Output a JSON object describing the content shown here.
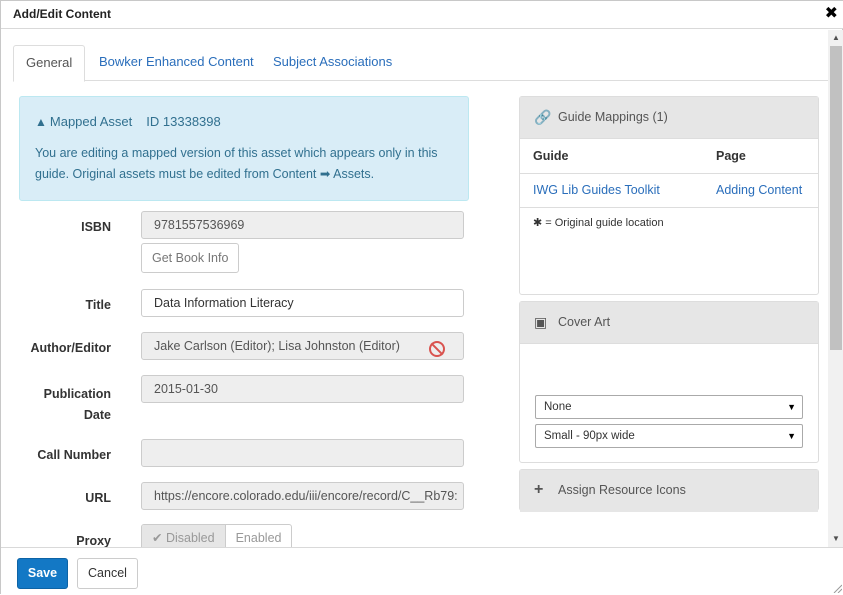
{
  "dialog": {
    "title": "Add/Edit Content",
    "close_glyph": "✖"
  },
  "tabs": [
    {
      "label": "General",
      "active": true
    },
    {
      "label": "Bowker Enhanced Content",
      "active": false
    },
    {
      "label": "Subject Associations",
      "active": false
    }
  ],
  "alert": {
    "icon": "warning-icon",
    "title": "Mapped Asset",
    "id_text": "ID 13338398",
    "message_part1": "You are editing a mapped version of this asset which appears only in this guide. Original assets must be edited from Content ",
    "arrow": "➡",
    "message_part2": " Assets."
  },
  "form": {
    "isbn": {
      "label": "ISBN",
      "value": "9781557536969",
      "button": "Get Book Info"
    },
    "title": {
      "label": "Title",
      "value": "Data Information Literacy"
    },
    "author": {
      "label": "Author/Editor",
      "value": "Jake Carlson (Editor); Lisa Johnston (Editor)"
    },
    "pubdate": {
      "label_line1": "Publication",
      "label_line2": "Date",
      "value": "2015-01-30"
    },
    "callnumber": {
      "label": "Call Number",
      "value": ""
    },
    "url": {
      "label": "URL",
      "value": "https://encore.colorado.edu/iii/encore/record/C__Rb79:"
    },
    "proxy": {
      "label": "Proxy",
      "disabled": "✔ Disabled",
      "enabled": "Enabled"
    }
  },
  "guide_mappings": {
    "title": "Guide Mappings (1)",
    "col_guide": "Guide",
    "col_page": "Page",
    "rows": [
      {
        "guide": "IWG Lib Guides Toolkit",
        "page": "Adding Content"
      }
    ],
    "note": "✱ = Original guide location"
  },
  "cover_art": {
    "title": "Cover Art",
    "select1": "None",
    "select2": "Small - 90px wide"
  },
  "resource_icons": {
    "title": "Assign Resource Icons"
  },
  "footer": {
    "save": "Save",
    "cancel": "Cancel"
  },
  "colors": {
    "primary": "#1378c5",
    "link": "#2a6ebb",
    "alert_bg": "#d9edf7",
    "alert_text": "#31708f"
  }
}
